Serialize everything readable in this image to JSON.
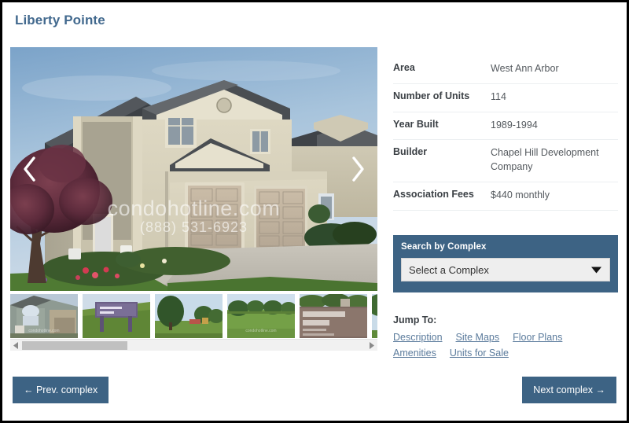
{
  "header": {
    "title": "Liberty Pointe",
    "title_color": "#42698e"
  },
  "gallery": {
    "prev_arrow_icon": "chevron-left-icon",
    "next_arrow_icon": "chevron-right-icon",
    "watermark_text": "condohotline.com",
    "watermark_phone": "(888) 531-6923",
    "thumbnail_watermark": "condohotline.com",
    "thumbnails": [
      {
        "alt": "Townhome exterior with arched window and garage"
      },
      {
        "alt": "Burr Oak Park wooden sign on grass hill"
      },
      {
        "alt": "Park with large tree and playground"
      },
      {
        "alt": "Open green park field with trees"
      },
      {
        "alt": "Burr Oak Park large stone sign"
      },
      {
        "alt": "White house behind trees"
      }
    ],
    "scrollbar": {
      "left_arrow_icon": "triangle-left-icon",
      "right_arrow_icon": "triangle-right-icon",
      "thumb_position_percent": 0
    }
  },
  "details": {
    "rows": [
      {
        "label": "Area",
        "value": "West Ann Arbor"
      },
      {
        "label": "Number of Units",
        "value": "114"
      },
      {
        "label": "Year Built",
        "value": "1989-1994"
      },
      {
        "label": "Builder",
        "value": "Chapel Hill Development Company"
      },
      {
        "label": "Association Fees",
        "value": "$440 monthly"
      }
    ]
  },
  "search_panel": {
    "title": "Search by Complex",
    "selected_option": "Select a Complex",
    "caret_icon": "triangle-down-icon",
    "panel_color": "#3d6384"
  },
  "jump_to": {
    "title": "Jump To:",
    "row1": [
      {
        "label": "Description"
      },
      {
        "label": "Site Maps"
      },
      {
        "label": "Floor Plans"
      }
    ],
    "row2": [
      {
        "label": "Amenities"
      },
      {
        "label": "Units for Sale"
      }
    ]
  },
  "footer": {
    "prev_label": "← Prev. complex",
    "next_label": "Next complex →",
    "button_color": "#3d6384"
  }
}
